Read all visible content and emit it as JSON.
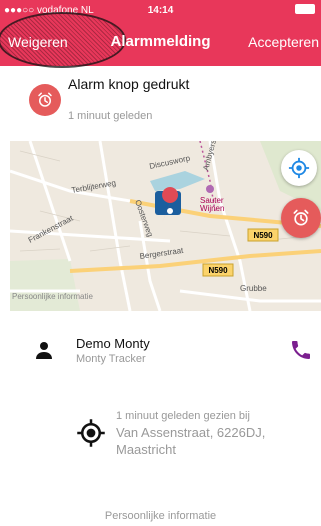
{
  "status_bar": {
    "carrier": "●●●○○ vodafone NL",
    "time": "14:14"
  },
  "nav": {
    "left": "Weigeren",
    "title": "Alarmmelding",
    "right": "Accepteren"
  },
  "alarm": {
    "title": "Alarm knop gedrukt",
    "time_ago": "1 minuut geleden"
  },
  "map": {
    "street_labels": [
      "Terblijterweg",
      "Discusworp",
      "Oosterweg",
      "Frankenstraat",
      "Bergerstraat",
      "Ambyerstr.",
      "Grubbe",
      "Sauter Wijnen"
    ],
    "road_badges": [
      "N590",
      "N590"
    ],
    "overlay_text": "Persoonlijke informatie"
  },
  "person": {
    "name": "Demo Monty",
    "device": "Monty Tracker"
  },
  "location": {
    "seen": "1 minuut geleden gezien bij",
    "address": "Van Assenstraat, 6226DJ, Maastricht"
  },
  "footer": {
    "label": "Persoonlijke informatie"
  },
  "colors": {
    "brand": "#e8375a",
    "alarm": "#e55b5b",
    "phone": "#7b1f8f",
    "locate": "#1e88e5"
  }
}
